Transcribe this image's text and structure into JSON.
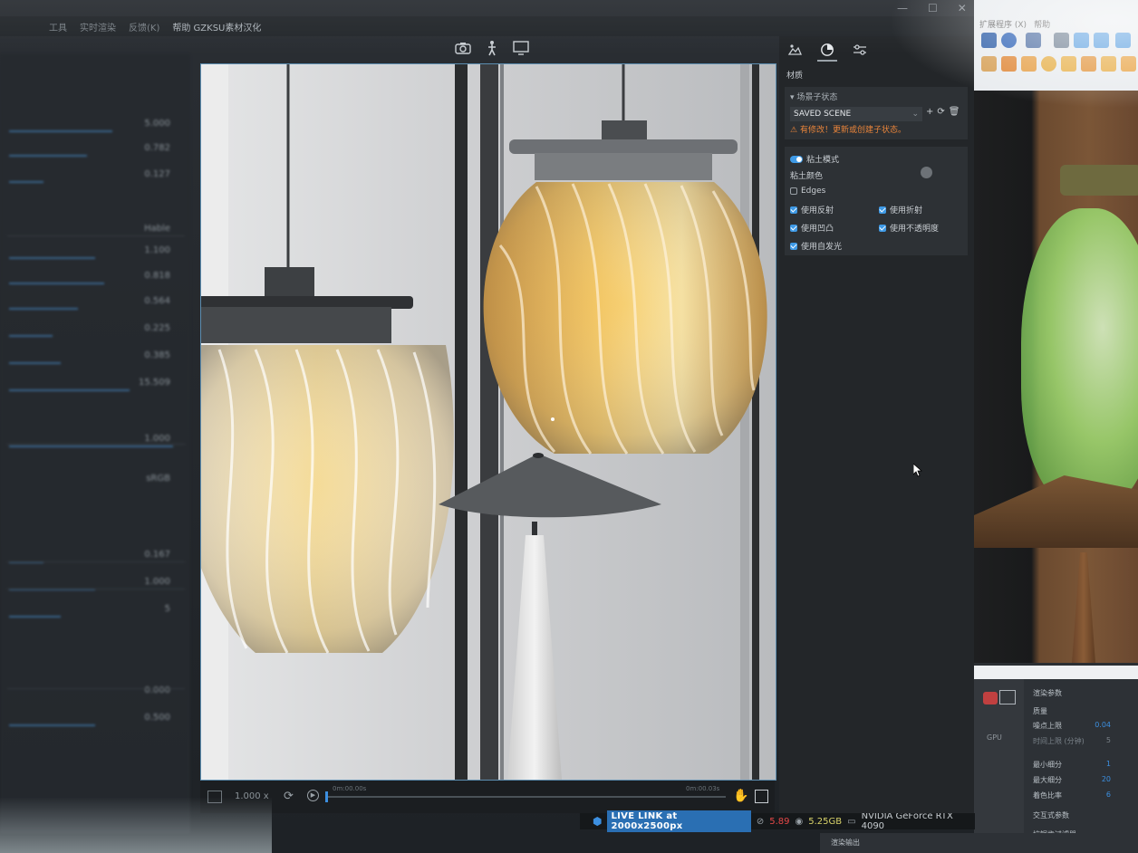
{
  "window": {
    "menu": [
      "",
      "",
      "",
      "工具",
      "实时渲染",
      "反馈(K)",
      "帮助 GZKSU素材汉化"
    ],
    "controls": [
      "—",
      "☐",
      "✕"
    ]
  },
  "left_panel": {
    "rows": [
      {
        "label": "",
        "value": "5.000",
        "fill": 0.6
      },
      {
        "label": "",
        "value": "0.782",
        "fill": 0.45
      },
      {
        "label": "",
        "value": "0.127",
        "fill": 0.2
      },
      {
        "label": "",
        "value": "Hable",
        "fill": 0
      },
      {
        "label": "",
        "value": "1.100",
        "fill": 0.5
      },
      {
        "label": "",
        "value": "0.818",
        "fill": 0.55
      },
      {
        "label": "",
        "value": "0.564",
        "fill": 0.4
      },
      {
        "label": "",
        "value": "0.225",
        "fill": 0.25
      },
      {
        "label": "",
        "value": "0.385",
        "fill": 0.3
      },
      {
        "label": "",
        "value": "15.509",
        "fill": 0.7
      },
      {
        "label": "",
        "value": "1.000",
        "fill": 0.95
      },
      {
        "label": "",
        "value": "sRGB",
        "fill": 0
      },
      {
        "label": "",
        "value": "0.167",
        "fill": 0.2
      },
      {
        "label": "",
        "value": "1.000",
        "fill": 0.5
      },
      {
        "label": "",
        "value": "5",
        "fill": 0.3
      },
      {
        "label": "",
        "value": "0.000",
        "fill": 0
      },
      {
        "label": "",
        "value": "0.500",
        "fill": 0.5
      }
    ]
  },
  "viewport": {
    "tools": [
      "camera-icon",
      "walk-icon",
      "monitor-icon"
    ]
  },
  "timeline": {
    "zoom": "1.000 x",
    "start": "0m:00.00s",
    "end": "0m:00.03s"
  },
  "status": {
    "live": "LIVE LINK at 2000x2500px",
    "fps": "5.89",
    "memory": "5.25GB",
    "gpu": "NVIDIA GeForce RTX 4090"
  },
  "panel": {
    "title": "材质",
    "scene_section": {
      "header": "场景子状态",
      "selected": "SAVED SCENE",
      "warning": "有修改！更新或创建子状态。"
    },
    "clay": {
      "mode_label": "粘土模式",
      "color_label": "粘土颜色",
      "edges_label": "Edges",
      "options": [
        {
          "label": "使用反射",
          "checked": true
        },
        {
          "label": "使用折射",
          "checked": true
        },
        {
          "label": "使用凹凸",
          "checked": true
        },
        {
          "label": "使用不透明度",
          "checked": true
        },
        {
          "label": "使用自发光",
          "checked": true
        }
      ]
    }
  },
  "right_window": {
    "menu": [
      "扩展程序 (X)",
      "帮助"
    ],
    "params": {
      "header": "渲染参数",
      "sub": "质量",
      "rows": [
        {
          "label": "噪点上限",
          "value": "0.04"
        },
        {
          "label": "时间上限 (分钟)",
          "value": "5"
        },
        {
          "label": "最小细分",
          "value": "1"
        },
        {
          "label": "最大细分",
          "value": "20"
        },
        {
          "label": "着色比率",
          "value": "6"
        }
      ],
      "more": [
        "交互式参数",
        "抗锯齿过滤器"
      ],
      "bottom": "渲染输出",
      "gpu": "GPU"
    }
  }
}
